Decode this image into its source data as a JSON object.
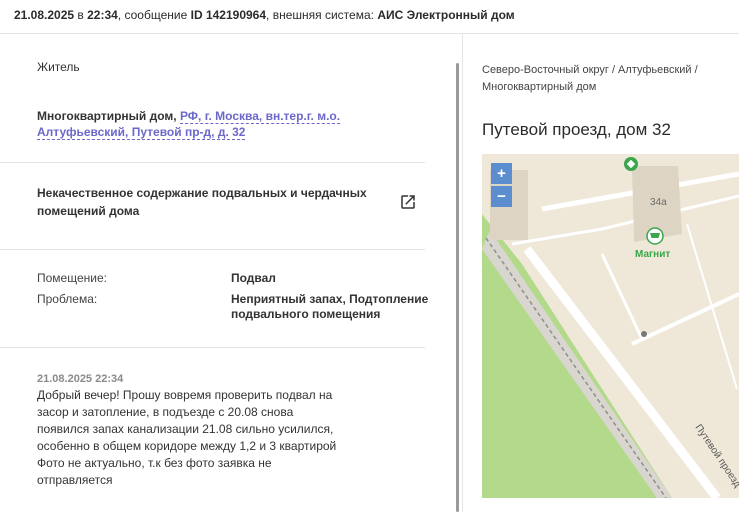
{
  "header": {
    "date": "21.08.2025",
    "in": "в",
    "time": "22:34",
    "message_label": ", сообщение",
    "message_id": "ID 142190964",
    "system_label": ", внешняя система:",
    "system_name": "АИС Электронный дом"
  },
  "role": "Житель",
  "address": {
    "prefix": "Многоквартирный дом, ",
    "link": "РФ, г. Москва, вн.тер.г. м.о. Алтуфьевский, Путевой пр-д, д. 32"
  },
  "issue": {
    "title": "Некачественное содержание подвальных и чердачных помещений дома",
    "icon": "external-link-icon"
  },
  "details": [
    {
      "label": "Помещение:",
      "value": "Подвал"
    },
    {
      "label": "Проблема:",
      "value": "Неприятный запах, Подтопление подвального помещения"
    }
  ],
  "message": {
    "timestamp": "21.08.2025 22:34",
    "text": "Добрый вечер! Прошу вовремя проверить подвал на засор и затопление, в подъезде с 20.08 снова появился запах канализации 21.08 сильно усилился, особенно в общем коридоре между 1,2 и 3 квартирой Фото не актуально, т.к без фото заявка не отправляется"
  },
  "map": {
    "breadcrumb": "Северо-Восточный округ / Алтуфьевский / Многоквартирный дом",
    "title": "Путевой проезд, дом 32",
    "zoom_in": "+",
    "zoom_out": "−",
    "building_number": "34а",
    "store_name": "Магнит",
    "street_name": "Путевой проезд",
    "colors": {
      "park": "#b3d98a",
      "land": "#efe8d9",
      "road": "#ffffff",
      "building": "#ddd4c3",
      "accent": "#5c8dce",
      "store": "#3aa64a"
    }
  }
}
